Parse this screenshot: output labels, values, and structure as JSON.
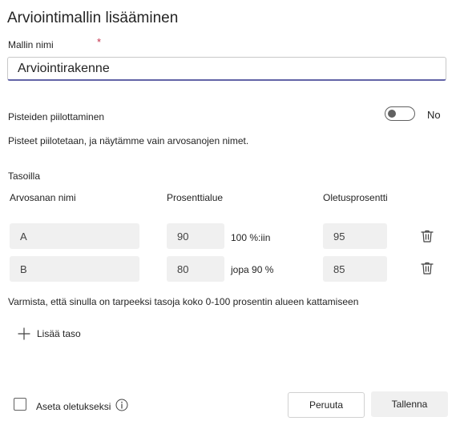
{
  "dialog": {
    "title": "Arviointimallin lisääminen",
    "name_label": "Mallin nimi",
    "required_marker": "*",
    "name_value": "Arviointirakenne",
    "hide_points_label": "Pisteiden piilottaminen",
    "hide_points_state": "No",
    "hide_points_description": "Pisteet piilotetaan, ja näytämme vain arvosanojen nimet.",
    "levels_heading": "Tasoilla",
    "columns": {
      "grade_name": "Arvosanan nimi",
      "percent_range": "Prosenttialue",
      "default_percent": "Oletusprosentti"
    },
    "levels": [
      {
        "name": "A",
        "min_percent": "90",
        "range_text": "100 %:iin",
        "default": "95"
      },
      {
        "name": "B",
        "min_percent": "80",
        "range_text": "jopa 90 %",
        "default": "85"
      }
    ],
    "coverage_notice": "Varmista, että sinulla on tarpeeksi tasoja koko 0-100 prosentin alueen kattamiseen",
    "add_level_label": "Lisää taso",
    "set_default_label": "Aseta oletukseksi",
    "cancel_label": "Peruuta",
    "save_label": "Tallenna"
  },
  "icons": {
    "add": "plus-icon",
    "delete": "trash-icon",
    "info": "info-icon"
  },
  "colors": {
    "accent": "#6264a7",
    "required": "#c4314b",
    "field_bg": "#f0f0f0"
  }
}
